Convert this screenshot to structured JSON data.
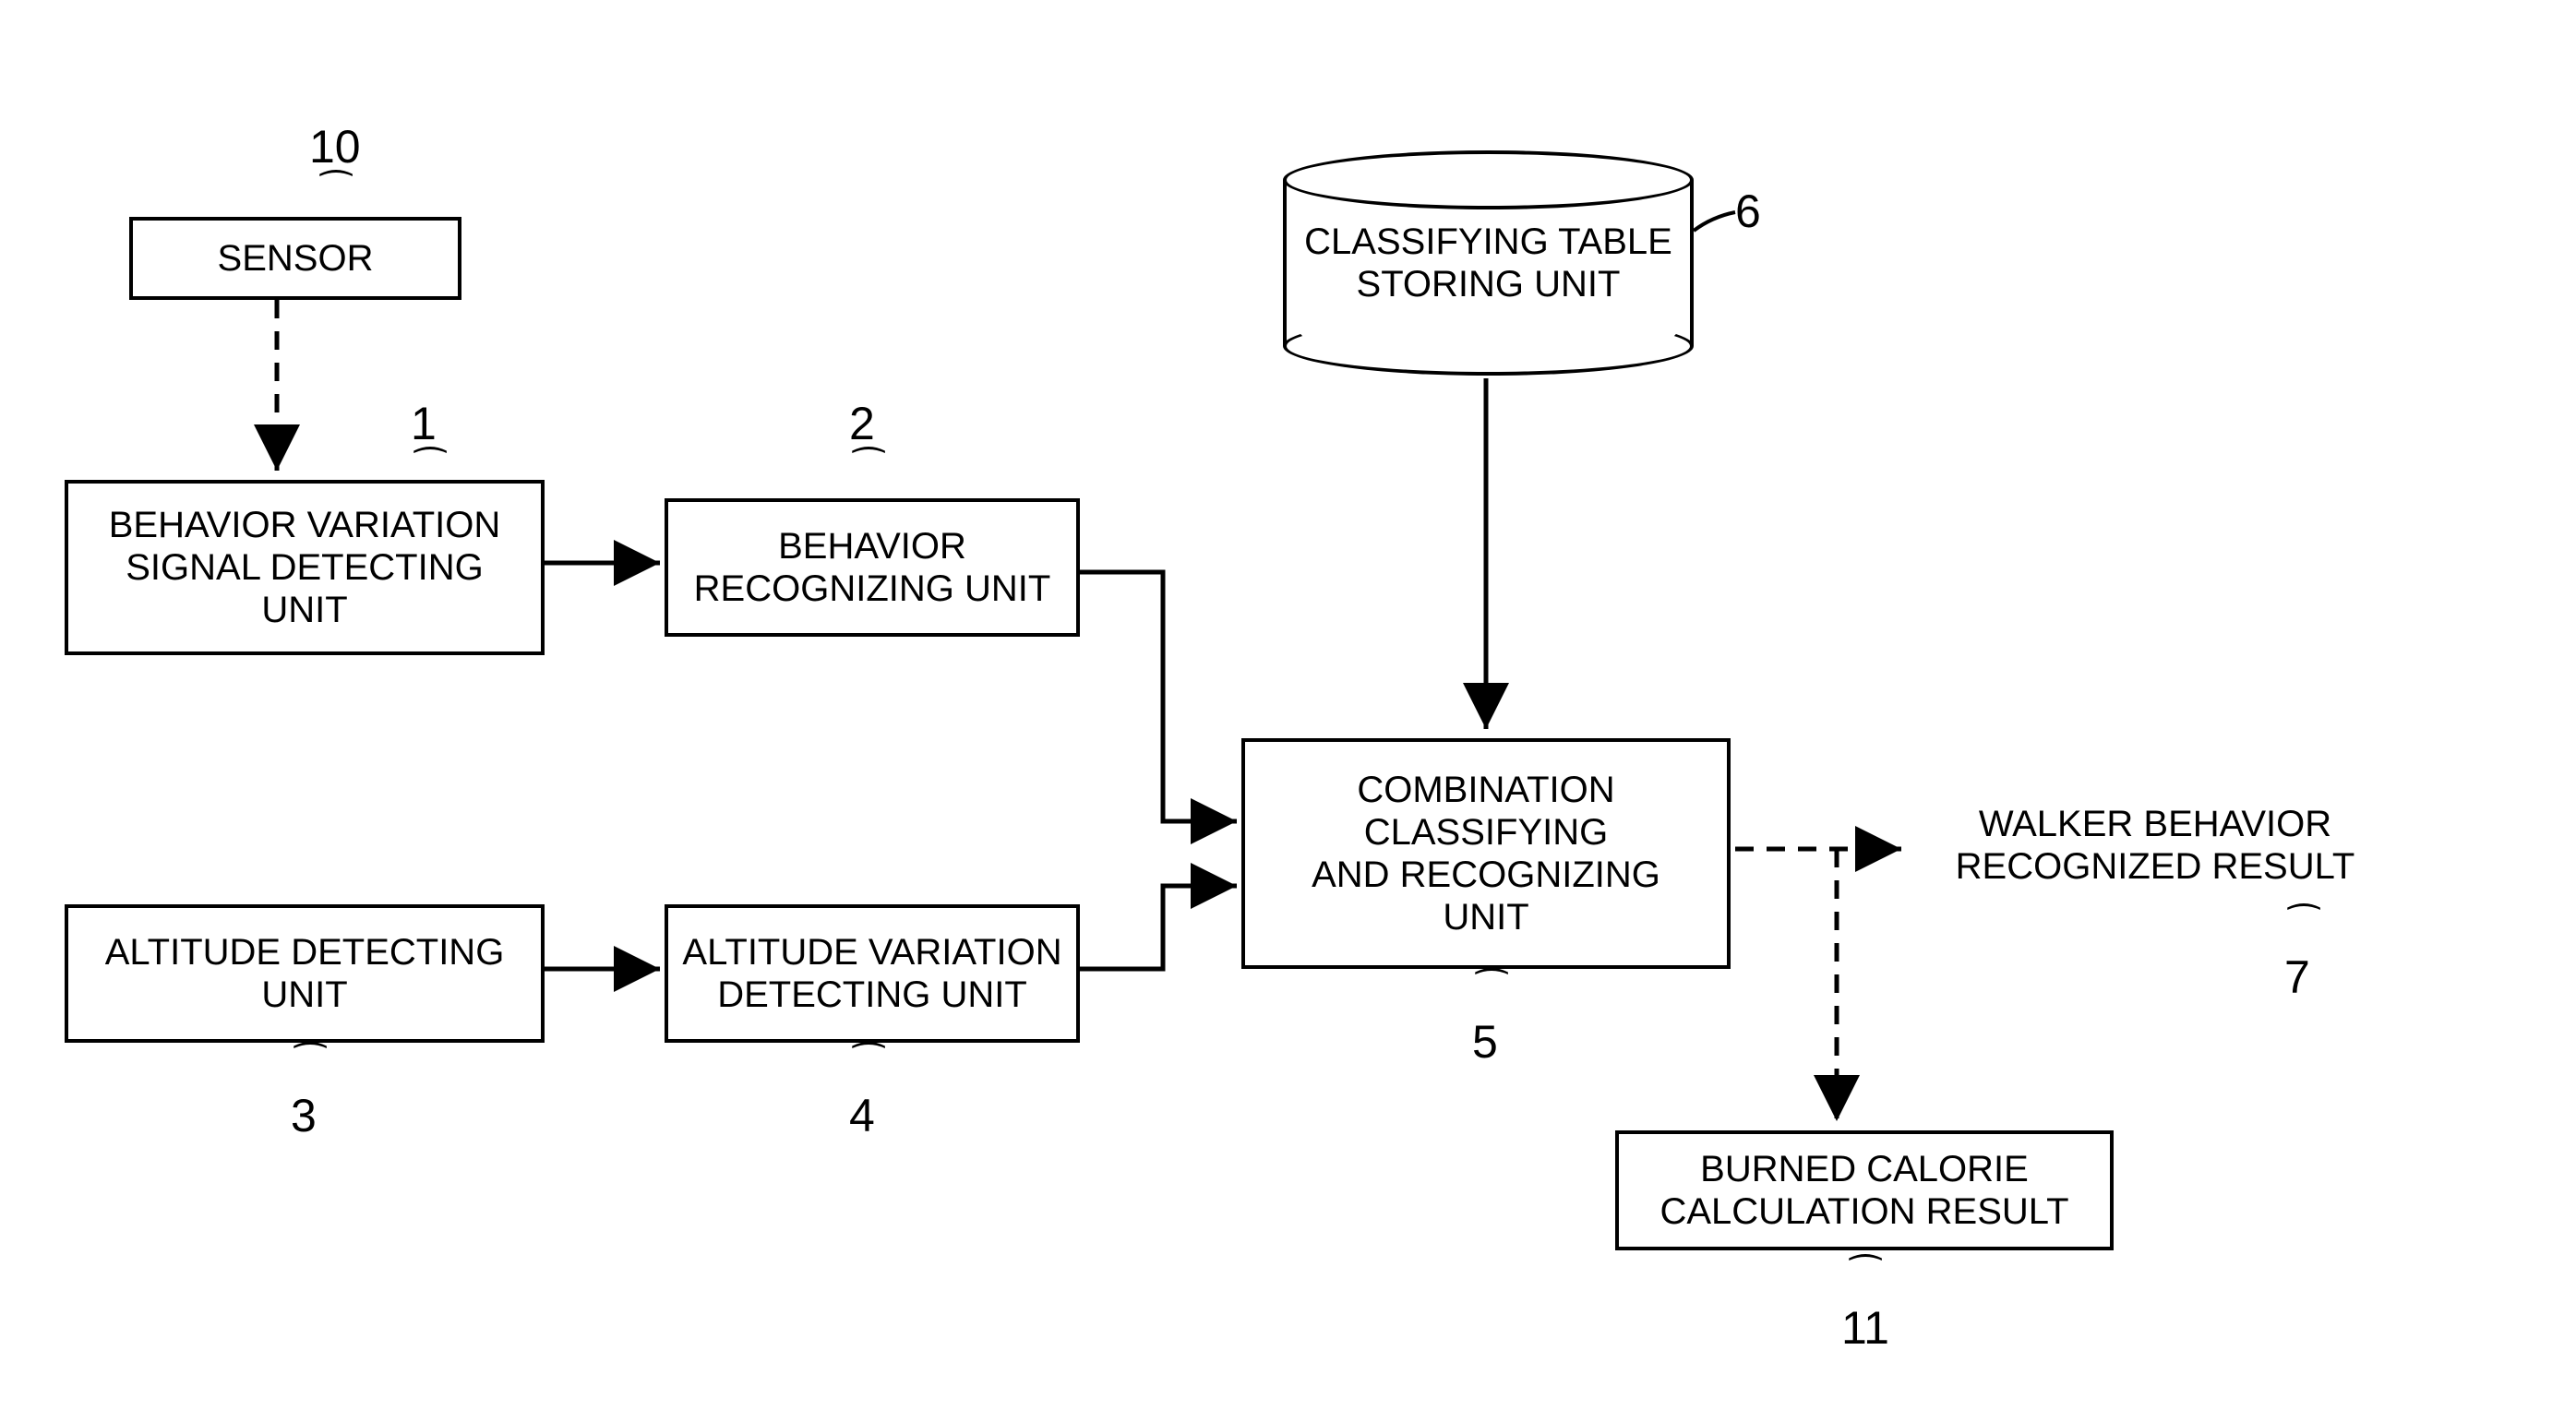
{
  "nodes": {
    "sensor": {
      "num": "10",
      "text": "SENSOR"
    },
    "bvsd": {
      "num": "1",
      "text": "BEHAVIOR VARIATION\nSIGNAL DETECTING\nUNIT"
    },
    "brec": {
      "num": "2",
      "text": "BEHAVIOR\nRECOGNIZING UNIT"
    },
    "altdet": {
      "num": "3",
      "text": "ALTITUDE DETECTING\nUNIT"
    },
    "altvar": {
      "num": "4",
      "text": "ALTITUDE VARIATION\nDETECTING UNIT"
    },
    "combo": {
      "num": "5",
      "text": "COMBINATION\nCLASSIFYING\nAND RECOGNIZING\nUNIT"
    },
    "store": {
      "num": "6",
      "text": "CLASSIFYING TABLE\nSTORING UNIT"
    },
    "result": {
      "num": "7",
      "text": "WALKER BEHAVIOR\nRECOGNIZED RESULT"
    },
    "calorie": {
      "num": "11",
      "text": "BURNED CALORIE\nCALCULATION RESULT"
    }
  }
}
